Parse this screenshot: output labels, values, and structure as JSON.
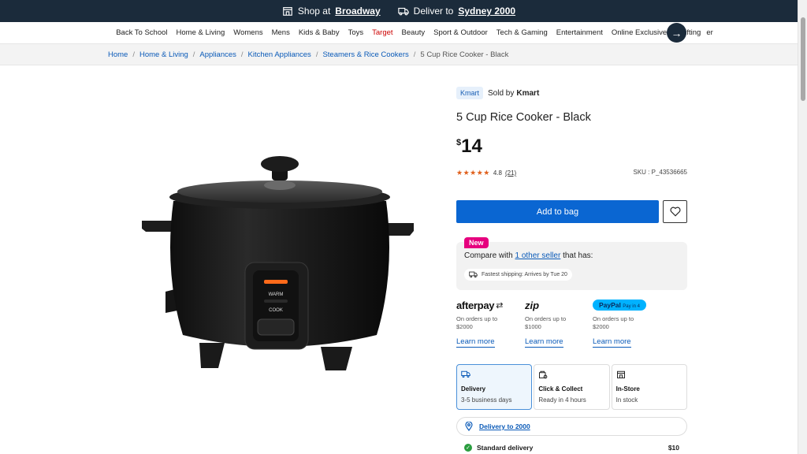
{
  "topbar": {
    "shop_prefix": "Shop at",
    "shop_store": "Broadway",
    "deliver_prefix": "Deliver to",
    "deliver_location": "Sydney 2000"
  },
  "categories": [
    "Back To School",
    "Home & Living",
    "Womens",
    "Mens",
    "Kids & Baby",
    "Toys",
    "Target",
    "Beauty",
    "Sport & Outdoor",
    "Tech & Gaming",
    "Entertainment",
    "Online Exclusives",
    "Gifting",
    "er"
  ],
  "breadcrumb": [
    "Home",
    "Home & Living",
    "Appliances",
    "Kitchen Appliances",
    "Steamers & Rice Cookers"
  ],
  "breadcrumb_current": "5 Cup Rice Cooker - Black",
  "product": {
    "brand_badge": "Kmart",
    "sold_by_prefix": "Sold by",
    "sold_by": "Kmart",
    "title": "5 Cup Rice Cooker - Black",
    "currency": "$",
    "price": "14",
    "stars": "★★★★★",
    "rating": "4.8",
    "review_count": "(21)",
    "sku": "SKU : P_43536665",
    "image_labels": {
      "warm": "WARM",
      "cook": "COOK"
    }
  },
  "actions": {
    "add_to_bag": "Add to bag"
  },
  "compare": {
    "badge": "New",
    "prefix": "Compare with",
    "link": "1 other seller",
    "suffix": "that has:",
    "fast_shipping": "Fastest shipping: Arrives by Tue 20"
  },
  "payments": [
    {
      "logo": "afterpay",
      "line1": "On orders up to",
      "line2": "$2000",
      "learn": "Learn more"
    },
    {
      "logo": "zip",
      "line1": "On orders up to",
      "line2": "$1000",
      "learn": "Learn more"
    },
    {
      "logo": "PayPal",
      "logo_small": "Pay in 4",
      "line1": "On orders up to",
      "line2": "$2000",
      "learn": "Learn more"
    }
  ],
  "delivery_options": [
    {
      "title": "Delivery",
      "detail": "3-5 business days"
    },
    {
      "title": "Click & Collect",
      "detail": "Ready in 4 hours"
    },
    {
      "title": "In-Store",
      "detail": "In stock"
    }
  ],
  "deliver_to": "Delivery to 2000",
  "standard_delivery": {
    "label": "Standard delivery",
    "price": "$10"
  },
  "colors": {
    "header": "#1b2b3b",
    "primary": "#0a66d2",
    "link": "#0a5ab8",
    "star": "#e0601c",
    "new_badge": "#e6007e"
  }
}
